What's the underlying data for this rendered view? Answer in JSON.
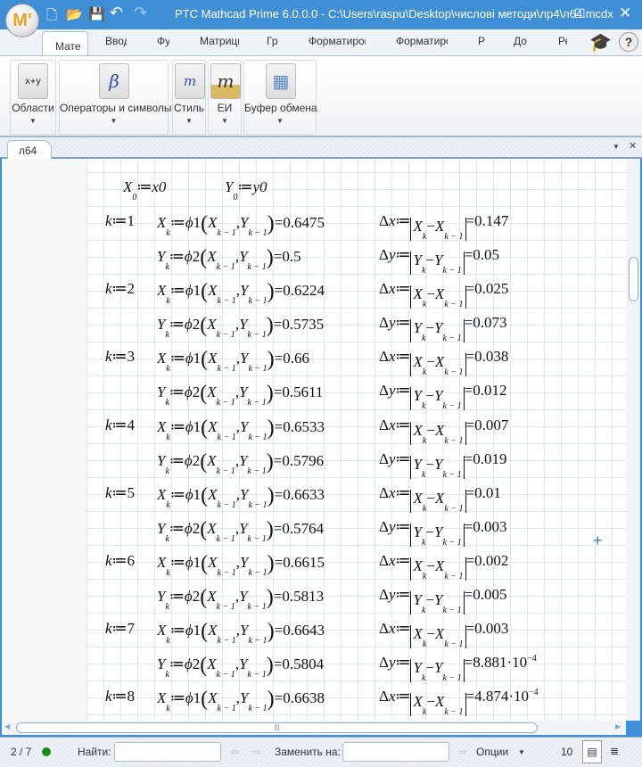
{
  "titlebar": {
    "title": "PTC Mathcad Prime 6.0.0.0 - C:\\Users\\raspu\\Desktop\\числові методи\\лр4\\л64.mcdx",
    "logo": "M'"
  },
  "tabs": [
    "Мате",
    "Ввод",
    "Фу",
    "Матрицы",
    "Гр",
    "Форматиров",
    "Форматиро",
    "Р",
    "До",
    "Ре"
  ],
  "ribbon": {
    "groups": [
      {
        "label": "Области",
        "icon": "x+y"
      },
      {
        "label": "Операторы и символы",
        "icon": "β"
      },
      {
        "label": "Стиль",
        "icon": "m"
      },
      {
        "label": "ЕИ",
        "icon": "m"
      },
      {
        "label": "Буфер обмена",
        "icon": "▦"
      }
    ]
  },
  "document": {
    "tab": "л64"
  },
  "init": {
    "x_var": "X",
    "x_sub": "0",
    "x_val": "x0",
    "y_var": "Y",
    "y_sub": "0",
    "y_val": "y0"
  },
  "iterations": [
    {
      "k": "1",
      "x": "0.6475",
      "y": "0.5",
      "dx": "0.147",
      "dy": "0.05"
    },
    {
      "k": "2",
      "x": "0.6224",
      "y": "0.5735",
      "dx": "0.025",
      "dy": "0.073"
    },
    {
      "k": "3",
      "x": "0.66",
      "y": "0.5611",
      "dx": "0.038",
      "dy": "0.012"
    },
    {
      "k": "4",
      "x": "0.6533",
      "y": "0.5796",
      "dx": "0.007",
      "dy": "0.019"
    },
    {
      "k": "5",
      "x": "0.6633",
      "y": "0.5764",
      "dx": "0.01",
      "dy": "0.003"
    },
    {
      "k": "6",
      "x": "0.6615",
      "y": "0.5813",
      "dx": "0.002",
      "dy": "0.005"
    },
    {
      "k": "7",
      "x": "0.6643",
      "y": "0.5804",
      "dx": "0.003",
      "dy": "8.881·10^−4"
    },
    {
      "k": "8",
      "x": "0.6638",
      "dx": "4.874·10^−4"
    }
  ],
  "status": {
    "page": "2 / 7",
    "find_label": "Найти:",
    "find_value": "",
    "replace_label": "Заменить на:",
    "replace_value": "",
    "options": "Опции",
    "zoom": "10"
  },
  "colors": {
    "titlebar": "#3f8fd6",
    "status_ok": "#1a8a1a"
  }
}
